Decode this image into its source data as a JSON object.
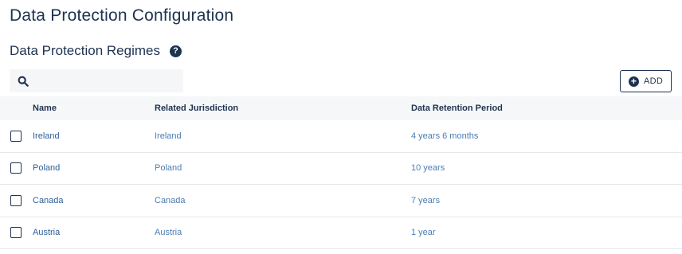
{
  "page": {
    "title": "Data Protection Configuration"
  },
  "section": {
    "title": "Data Protection Regimes",
    "help_icon": "?"
  },
  "search": {
    "value": "",
    "placeholder": "",
    "icon": "search-icon"
  },
  "toolbar": {
    "add_label": "ADD",
    "add_icon": "plus-circle-icon"
  },
  "table": {
    "columns": [
      "Name",
      "Related Jurisdiction",
      "Data Retention Period"
    ],
    "rows": [
      {
        "name": "Ireland",
        "jurisdiction": "Ireland",
        "retention": "4 years 6 months",
        "checked": false
      },
      {
        "name": "Poland",
        "jurisdiction": "Poland",
        "retention": "10 years",
        "checked": false
      },
      {
        "name": "Canada",
        "jurisdiction": "Canada",
        "retention": "7 years",
        "checked": false
      },
      {
        "name": "Austria",
        "jurisdiction": "Austria",
        "retention": "1 year",
        "checked": false
      }
    ]
  },
  "colors": {
    "primary": "#1e3350",
    "link": "#2d5f9a",
    "header_bg": "#f6f7f9",
    "search_bg": "#f5f6f8"
  }
}
